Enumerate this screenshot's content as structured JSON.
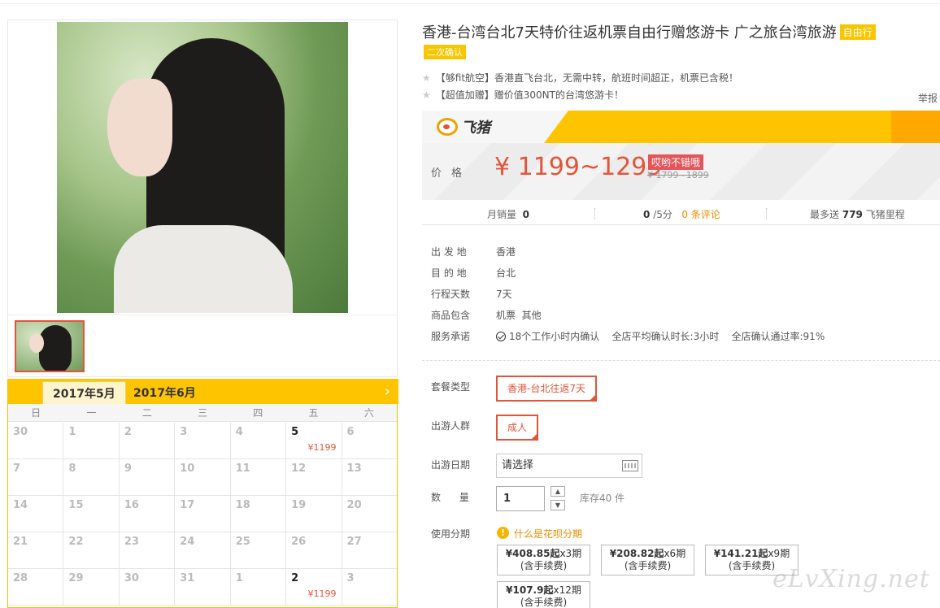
{
  "product": {
    "title": "香港-台湾台北7天特价往返机票自由行赠悠游卡 广之旅台湾旅游",
    "tag_free": "自由行",
    "tag_confirm": "二次确认",
    "features": [
      "【够fit航空】香港直飞台北，无需中转，航班时间超正，机票已含税！",
      "【超值加赠】赠价值300NT的台湾悠游卡！"
    ],
    "report": "举报"
  },
  "banner": {
    "brand": "飞猪"
  },
  "price": {
    "label": "价格",
    "value": "¥ 1199~1299",
    "promo": "哎哟不错哦",
    "original": "¥ 1799~1899"
  },
  "stats": {
    "monthly_label": "月销量",
    "monthly_value": "0",
    "rating_value": "0",
    "rating_suffix": "/5分",
    "reviews": "0 条评论",
    "miles_prefix": "最多送",
    "miles_value": "779",
    "miles_suffix": "飞猪里程"
  },
  "attributes": [
    {
      "label": "出 发 地",
      "value": "香港"
    },
    {
      "label": "目 的 地",
      "value": "台北"
    },
    {
      "label": "行程天数",
      "value": "7天"
    },
    {
      "label": "商品包含",
      "value": "机票  其他"
    }
  ],
  "service": {
    "label": "服务承诺",
    "items": [
      "18个工作小时内确认",
      "全店平均确认时长:3小时",
      "全店确认通过率:91%"
    ]
  },
  "options": {
    "package_label": "套餐类型",
    "package_value": "香港-台北往返7天",
    "people_label": "出游人群",
    "people_value": "成人",
    "date_label": "出游日期",
    "date_placeholder": "请选择",
    "qty_label": "数      量",
    "qty_value": "1",
    "stock": "库存40 件",
    "installment_label": "使用分期",
    "installment_link": "什么是花呗分期",
    "installments": [
      {
        "amount": "¥408.85起",
        "period": "x3期",
        "fee": "(含手续费)"
      },
      {
        "amount": "¥208.82起",
        "period": "x6期",
        "fee": "(含手续费)"
      },
      {
        "amount": "¥141.21起",
        "period": "x9期",
        "fee": "(含手续费)"
      },
      {
        "amount": "¥107.9起",
        "period": "x12期",
        "fee": "(含手续费)"
      }
    ]
  },
  "calendar": {
    "tab_current": "2017年5月",
    "tab_next": "2017年6月",
    "weekdays": [
      "日",
      "一",
      "二",
      "三",
      "四",
      "五",
      "六"
    ],
    "rows": [
      [
        {
          "d": "30"
        },
        {
          "d": "1"
        },
        {
          "d": "2"
        },
        {
          "d": "3"
        },
        {
          "d": "4"
        },
        {
          "d": "5",
          "p": "¥1199"
        },
        {
          "d": "6"
        }
      ],
      [
        {
          "d": "7"
        },
        {
          "d": "8"
        },
        {
          "d": "9"
        },
        {
          "d": "10"
        },
        {
          "d": "11"
        },
        {
          "d": "12"
        },
        {
          "d": "13"
        }
      ],
      [
        {
          "d": "14"
        },
        {
          "d": "15"
        },
        {
          "d": "16"
        },
        {
          "d": "17"
        },
        {
          "d": "18"
        },
        {
          "d": "19"
        },
        {
          "d": "20"
        }
      ],
      [
        {
          "d": "21"
        },
        {
          "d": "22"
        },
        {
          "d": "23"
        },
        {
          "d": "24"
        },
        {
          "d": "25"
        },
        {
          "d": "26"
        },
        {
          "d": "27"
        }
      ],
      [
        {
          "d": "28"
        },
        {
          "d": "29"
        },
        {
          "d": "30"
        },
        {
          "d": "31"
        },
        {
          "d": "1"
        },
        {
          "d": "2",
          "p": "¥1199"
        },
        {
          "d": "3"
        }
      ]
    ]
  },
  "watermark": "eLvXing.net",
  "colors": {
    "accent": "#ffc400",
    "price": "#e4543b",
    "link": "#f08c00"
  }
}
